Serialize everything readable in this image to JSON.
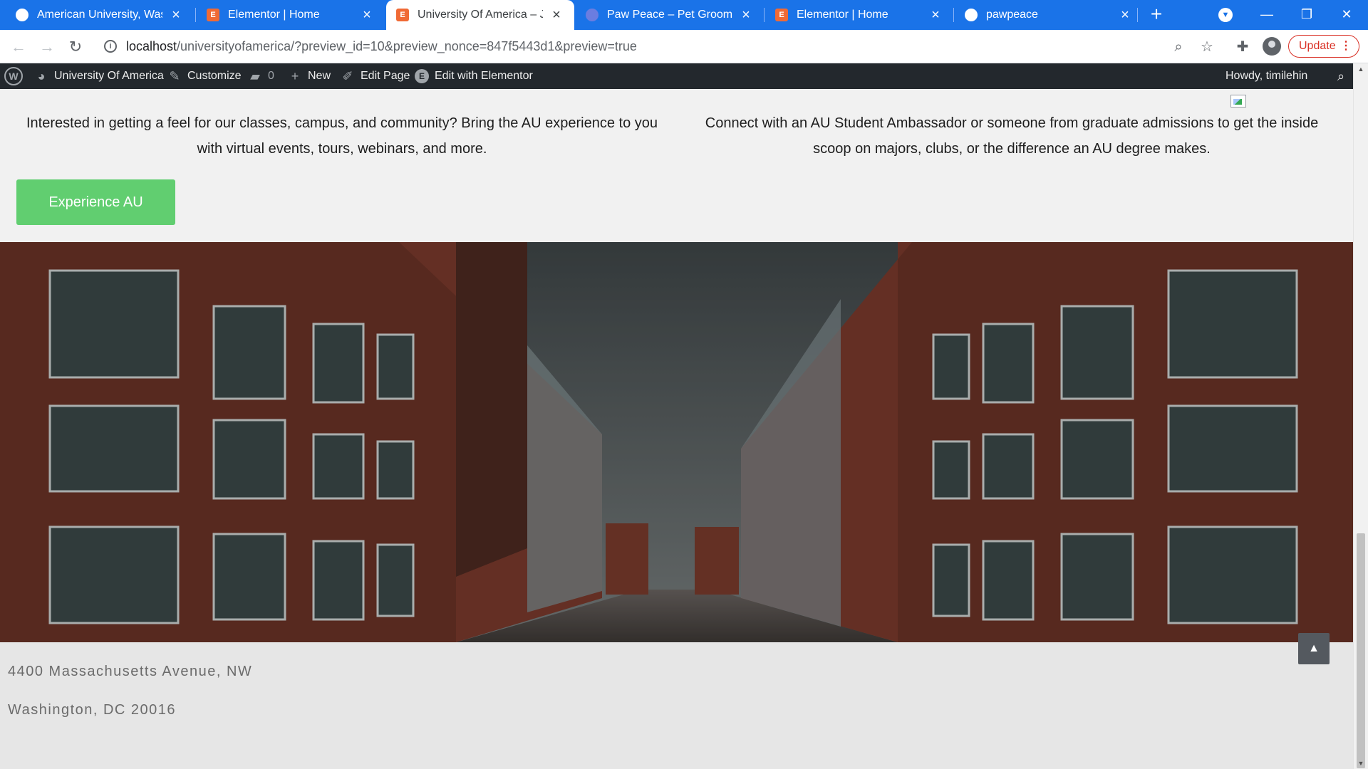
{
  "browser": {
    "tabs": [
      {
        "title": "American University, Washin",
        "favicon": "wordpress-icon"
      },
      {
        "title": "Elementor | Home",
        "favicon": "elementor-icon"
      },
      {
        "title": "University Of America – Just",
        "favicon": "elementor-icon",
        "active": true
      },
      {
        "title": "Paw Peace – Pet Grooming,",
        "favicon": "pawpeace-icon"
      },
      {
        "title": "Elementor | Home",
        "favicon": "elementor-icon"
      },
      {
        "title": "pawpeace",
        "favicon": "wordpress-icon"
      }
    ],
    "new_tab": "+",
    "url_host": "localhost",
    "url_path": "/universityofamerica/?preview_id=10&preview_nonce=847f5443d1&preview=true",
    "update_label": "Update"
  },
  "adminbar": {
    "site_name": "University Of America",
    "customize": "Customize",
    "comments_count": "0",
    "new": "New",
    "edit_page": "Edit Page",
    "edit_elementor": "Edit with Elementor",
    "howdy": "Howdy, timilehin"
  },
  "content": {
    "left_text": "Interested in getting a feel for our classes, campus, and community? Bring the AU experience to you with virtual events, tours, webinars, and more.",
    "right_text": "Connect with an AU Student Ambassador or someone from graduate admissions to get the inside scoop on majors, clubs, or the difference an AU degree makes.",
    "cta_label": "Experience AU"
  },
  "footer": {
    "address_line1": "4400 Massachusetts Avenue, NW",
    "address_line2": "Washington, DC 20016"
  },
  "colors": {
    "chrome_blue": "#1a73e8",
    "admin_bar": "#23282d",
    "cta_green": "#61ce70",
    "brick": "#7a3a2c"
  }
}
